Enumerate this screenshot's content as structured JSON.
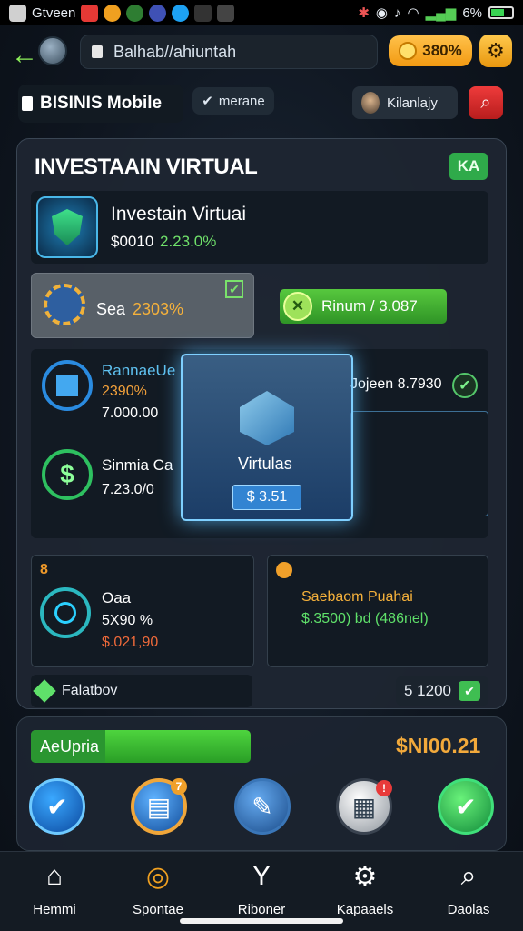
{
  "status_bar": {
    "app_name": "Gtveen",
    "battery": "6%"
  },
  "browser": {
    "url": "Balhab//ahiuntah",
    "coins": "380%"
  },
  "header": {
    "app_title": "BISINIS Mobile",
    "mode_label": "merane",
    "user_name": "Kilanlajy"
  },
  "panel": {
    "title": "INVESTAAIN VIRTUAL",
    "badge": "KA",
    "product": {
      "name": "Investain Virtuai",
      "price": "$0010",
      "change": "2.23.0%"
    },
    "sea": {
      "label": "Sea",
      "value": "2303%"
    },
    "premium_label": "Rinum / 3.087",
    "rows": [
      {
        "name": "RannaeUe",
        "pct": "2390%",
        "amount": "7.000.00"
      },
      {
        "name": "Sinmia Ca",
        "amount": "7.23.0/0"
      }
    ],
    "right_row": "Jojeen 8.7930",
    "overlay": {
      "label": "Virtulas",
      "price": "$ 3.51"
    },
    "card_a": {
      "num": "8",
      "name": "Oaa",
      "pct": "5X90 %",
      "amount": "$.021,90"
    },
    "card_b": {
      "name": "Saebaom Puahai",
      "amount": "$.3500) bd (486nel)"
    },
    "balance_label": "Falatbov",
    "balance_value": "5 1200"
  },
  "lower": {
    "upgrade_label": "AeUpria",
    "total": "$NI00.21",
    "badges": {
      "storage": "7",
      "calendar": "!"
    }
  },
  "bottom_nav": [
    {
      "label": "Hemmi",
      "icon": "home-icon"
    },
    {
      "label": "Spontae",
      "icon": "search-coin-icon"
    },
    {
      "label": "Riboner",
      "icon": "slingshot-icon"
    },
    {
      "label": "Kapaaels",
      "icon": "gear-icon"
    },
    {
      "label": "Daolas",
      "icon": "magnifier-icon"
    }
  ]
}
